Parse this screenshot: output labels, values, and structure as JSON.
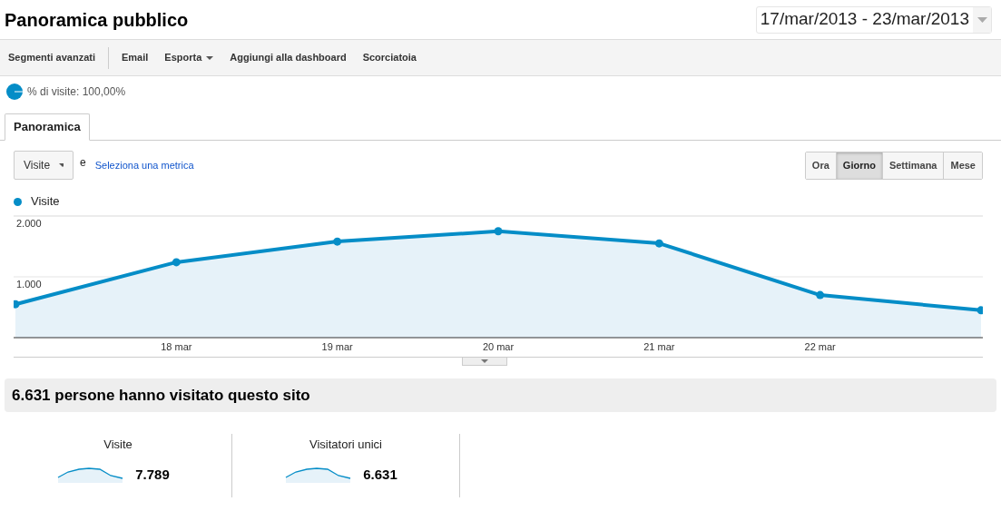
{
  "header": {
    "title": "Panoramica pubblico",
    "date_range": "17/mar/2013 - 23/mar/2013"
  },
  "toolbar": [
    {
      "label": "Segmenti avanzati",
      "kind": "item"
    },
    {
      "label": "Email",
      "kind": "item"
    },
    {
      "label": "Esporta",
      "kind": "menu"
    },
    {
      "label": "Aggiungi alla dashboard",
      "kind": "item"
    },
    {
      "label": "Scorciatoia",
      "kind": "item"
    }
  ],
  "segment": {
    "label": "% di visite: 100,00%"
  },
  "tabs": [
    {
      "label": "Panoramica",
      "selected": true
    }
  ],
  "metric_picker": {
    "metric": "Visite",
    "conjunction": "e",
    "link": "Seleziona una metrica"
  },
  "granularity": [
    {
      "label": "Ora",
      "selected": false
    },
    {
      "label": "Giorno",
      "selected": true
    },
    {
      "label": "Settimana",
      "selected": false
    },
    {
      "label": "Mese",
      "selected": false
    }
  ],
  "chart": {
    "chart_data": {
      "type": "area",
      "categories": [
        null,
        "18 mar",
        "19 mar",
        "20 mar",
        "21 mar",
        "22 mar",
        null
      ],
      "ylim": [
        0,
        2000
      ],
      "series": [
        {
          "name": "Visite",
          "color": "#058dc7",
          "values": [
            550,
            1240,
            1580,
            1750,
            1550,
            700,
            450
          ]
        }
      ],
      "yticks": [
        {
          "value": 1000,
          "label": "1.000"
        },
        {
          "value": 2000,
          "label": "2.000"
        }
      ]
    }
  },
  "summary": {
    "headline": "6.631 persone hanno visitato questo sito"
  },
  "metrics": [
    {
      "label": "Visite",
      "value": "7.789"
    },
    {
      "label": "Visitatori unici",
      "value": "6.631"
    }
  ]
}
